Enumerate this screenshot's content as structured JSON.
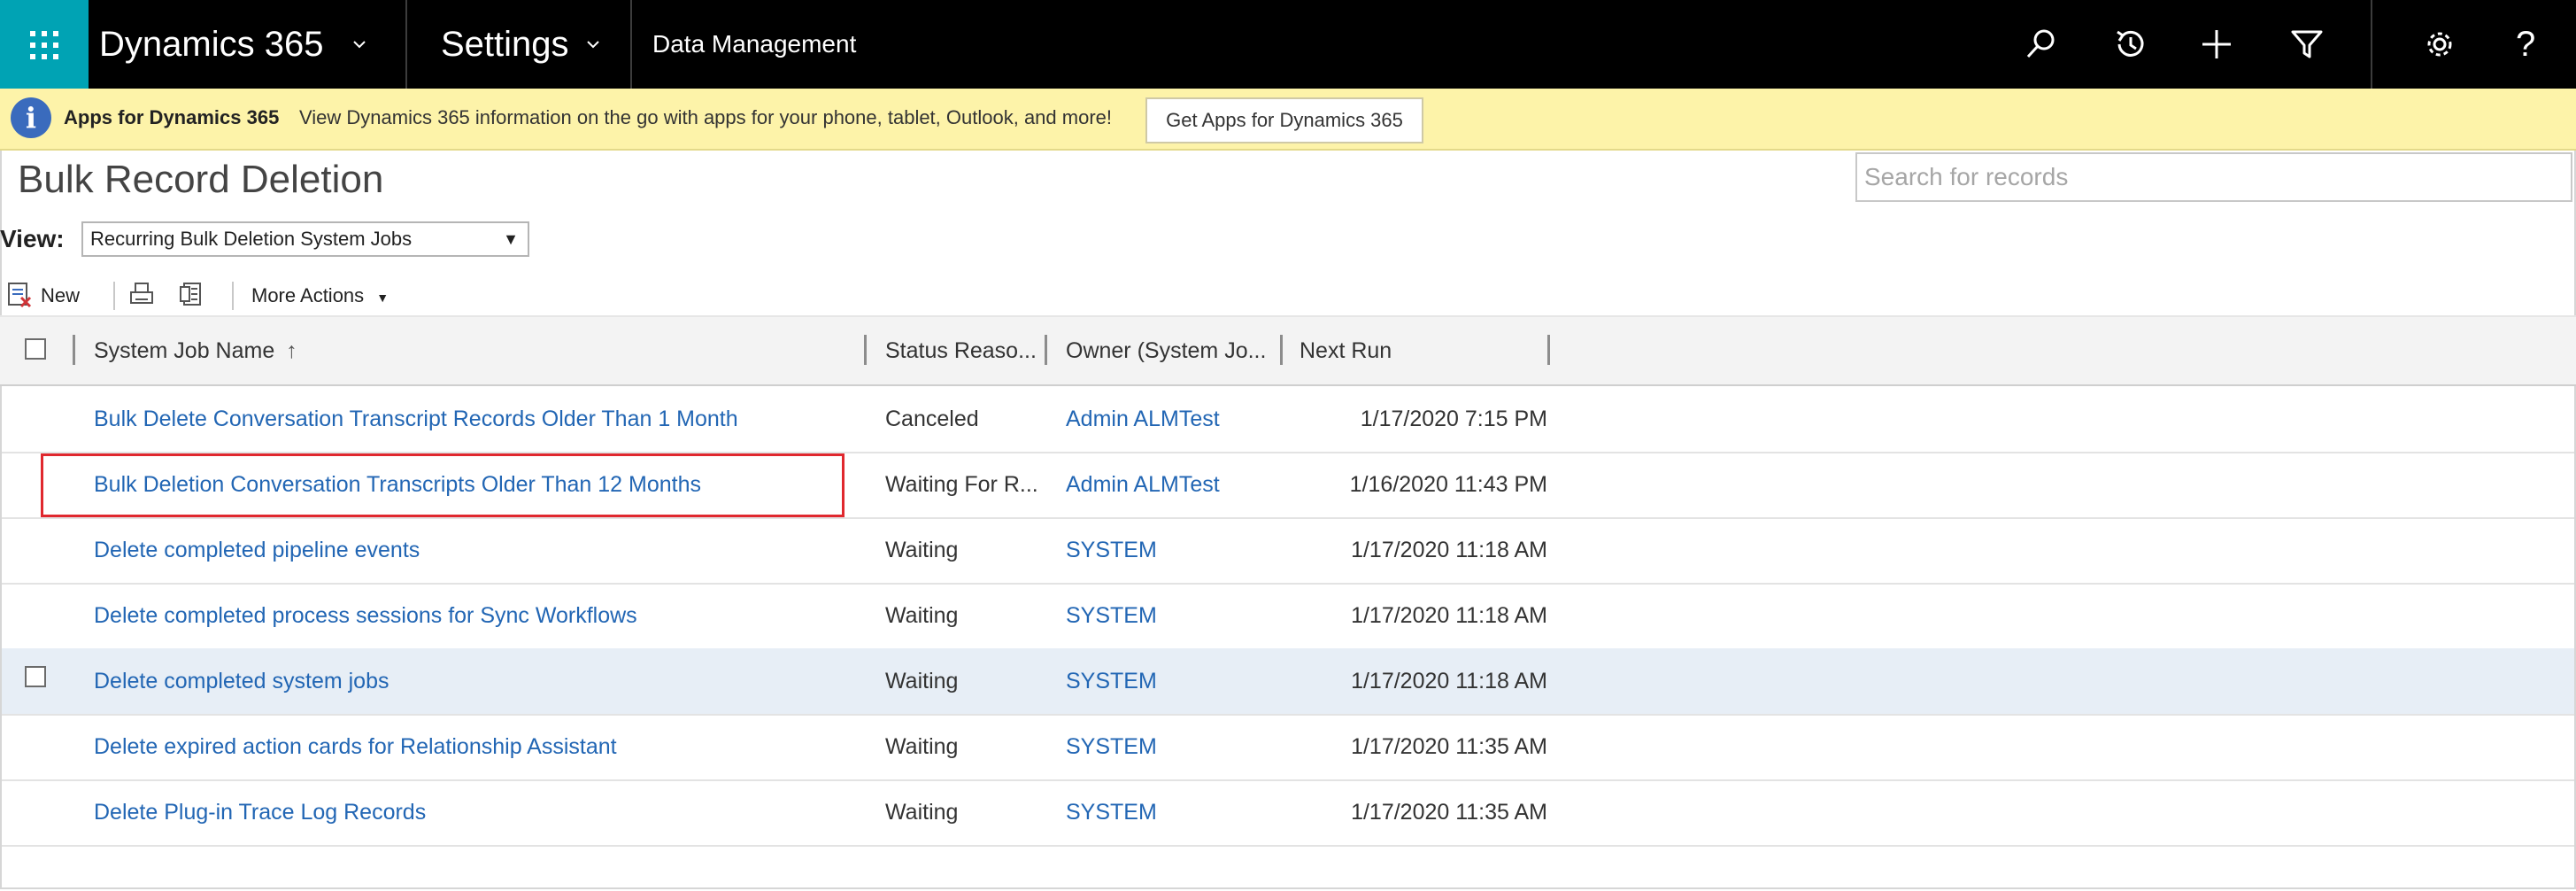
{
  "nav": {
    "brand": "Dynamics 365",
    "area": "Settings",
    "breadcrumb": "Data Management",
    "icons": [
      "search-icon",
      "history-icon",
      "plus-icon",
      "filter-icon",
      "gear-icon",
      "help-icon"
    ],
    "help_glyph": "?"
  },
  "notification": {
    "title": "Apps for Dynamics 365",
    "message": "View Dynamics 365 information on the go with apps for your phone, tablet, Outlook, and more!",
    "button_label": "Get Apps for Dynamics 365",
    "info_glyph": "i"
  },
  "page": {
    "title": "Bulk Record Deletion",
    "search_placeholder": "Search for records",
    "view_label": "View:",
    "view_selected": "Recurring Bulk Deletion System Jobs"
  },
  "commands": {
    "new_label": "New",
    "more_actions_label": "More Actions"
  },
  "grid": {
    "columns": [
      "System Job Name",
      "Status Reaso...",
      "Owner (System Jo...",
      "Next Run"
    ],
    "sort_indicator": "↑",
    "rows": [
      {
        "name": "Bulk Delete Conversation Transcript Records Older Than 1 Month",
        "status": "Canceled",
        "owner": "Admin ALMTest",
        "next_run": "1/17/2020 7:15 PM"
      },
      {
        "name": "Bulk Deletion Conversation Transcripts Older Than 12 Months",
        "status": "Waiting For R...",
        "owner": "Admin ALMTest",
        "next_run": "1/16/2020 11:43 PM"
      },
      {
        "name": "Delete completed pipeline events",
        "status": "Waiting",
        "owner": "SYSTEM",
        "next_run": "1/17/2020 11:18 AM"
      },
      {
        "name": "Delete completed process sessions for Sync Workflows",
        "status": "Waiting",
        "owner": "SYSTEM",
        "next_run": "1/17/2020 11:18 AM"
      },
      {
        "name": "Delete completed system jobs",
        "status": "Waiting",
        "owner": "SYSTEM",
        "next_run": "1/17/2020 11:18 AM"
      },
      {
        "name": "Delete expired action cards for Relationship Assistant",
        "status": "Waiting",
        "owner": "SYSTEM",
        "next_run": "1/17/2020 11:35 AM"
      },
      {
        "name": "Delete Plug-in Trace Log Records",
        "status": "Waiting",
        "owner": "SYSTEM",
        "next_run": "1/17/2020 11:35 AM"
      }
    ],
    "highlighted_row": 4,
    "outlined_row": 1
  },
  "colors": {
    "nav_bg": "#000000",
    "waffle_bg": "#00a3b4",
    "notify_bg": "#fdf3a9",
    "link": "#2266b4",
    "highlight_row": "#e7eef6",
    "annotation_box": "#e0282e"
  }
}
